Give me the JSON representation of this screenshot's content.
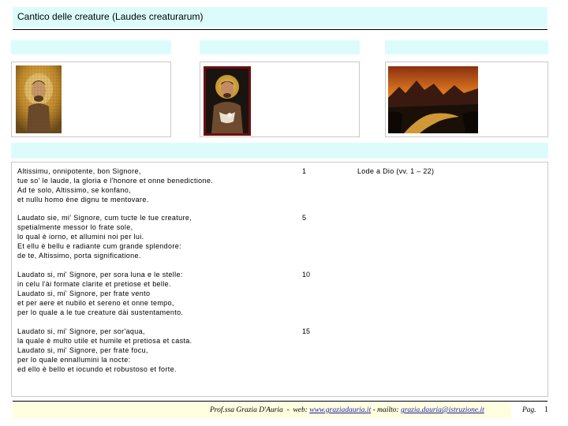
{
  "header": {
    "title": "Cantico delle creature (Laudes creaturarum)"
  },
  "images": [
    {
      "name": "mosaic-saint-francis",
      "description_icon": "portrait-icon"
    },
    {
      "name": "icon-saint-francis",
      "description_icon": "portrait-icon"
    },
    {
      "name": "sunset-landscape",
      "description_icon": "landscape-icon"
    }
  ],
  "stanzas": [
    {
      "text": "Altissimu, onnipotente, bon Signore,\ntue so' le laude, la gloria e l'honore et onne benedictione.\nAd te solo, Altissimo, se konfano,\net nullu homo ène dignu te mentovare.",
      "line_number": "1"
    },
    {
      "text": "Laudato sie, mi' Signore, cum tucte le tue creature,\nspetialmente messor lo frate sole,\nlo qual è iorno, et allumini noi per lui.\nEt ellu è bellu e radiante cum grande splendore:\nde te, Altissimo, porta significatione.",
      "line_number": "5"
    },
    {
      "text": "Laudato si, mi' Signore, per sora luna e le stelle:\nin celu l'ài formate clarite et pretiose et belle.\nLaudato si, mi' Signore, per frate vento\net per aere et nubilo et sereno et onne tempo,\nper lo quale a le tue creature dài sustentamento.",
      "line_number": "10"
    },
    {
      "text": "Laudato si, mi' Signore, per sor'aqua,\nla quale è multo utile et humile et pretiosa et casta.\nLaudato si, mi' Signore, per frate focu,\nper lo quale ennallumini la nocte:\ned ello è bello et iocundo et robustoso et forte.",
      "line_number": "15"
    }
  ],
  "note": "Lode a Dio (vv. 1 – 22)",
  "footer": {
    "author": "Prof.ssa Grazia D'Auria",
    "sep1": "-",
    "web_label": "web:",
    "web_link": "www.graziadauria.it",
    "sep2": "- mailto:",
    "mail_link": "grazia.dauria@istruzione.it",
    "page_label": "Pag.",
    "page_number": "1"
  },
  "colors": {
    "band": "#dcfcfc",
    "footer_highlight": "#ffffe0",
    "link": "#1a1aa6"
  }
}
